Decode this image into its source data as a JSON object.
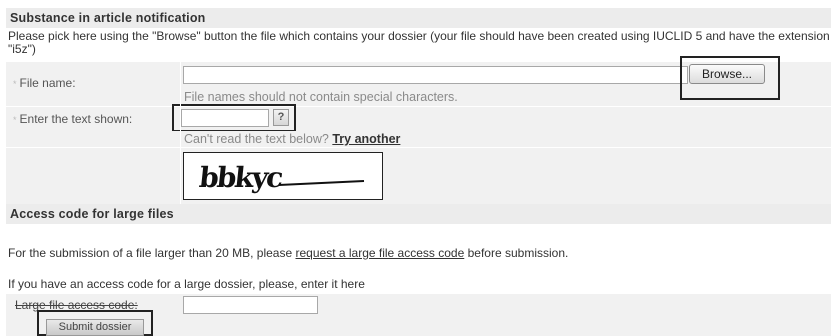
{
  "notification": {
    "title": "Substance in article notification",
    "intro": "Please pick here using the \"Browse\" button the file which contains your dossier (your file should have been created using IUCLID 5 and have the extension \"i5z\")",
    "file_label": "File name:",
    "file_value": "",
    "browse_label": "Browse...",
    "file_hint": "File names should not contain special characters.",
    "captcha_label": "Enter the text shown:",
    "captcha_value": "",
    "help_label": "?",
    "captcha_prompt": "Can't read the text below?",
    "try_another": "Try another",
    "captcha_text": "bbkyc",
    "required_mark": "*"
  },
  "access": {
    "title": "Access code for large files",
    "sentence_prefix": "For the submission of a file larger than 20 MB, please",
    "link_text": "request a large file access code",
    "sentence_suffix": "before submission.",
    "code_intro": "If you have an access code for a large dossier, please, enter it here",
    "code_label": "Large file access code:",
    "code_value": ""
  },
  "submit": {
    "label": "Submit dossier"
  }
}
